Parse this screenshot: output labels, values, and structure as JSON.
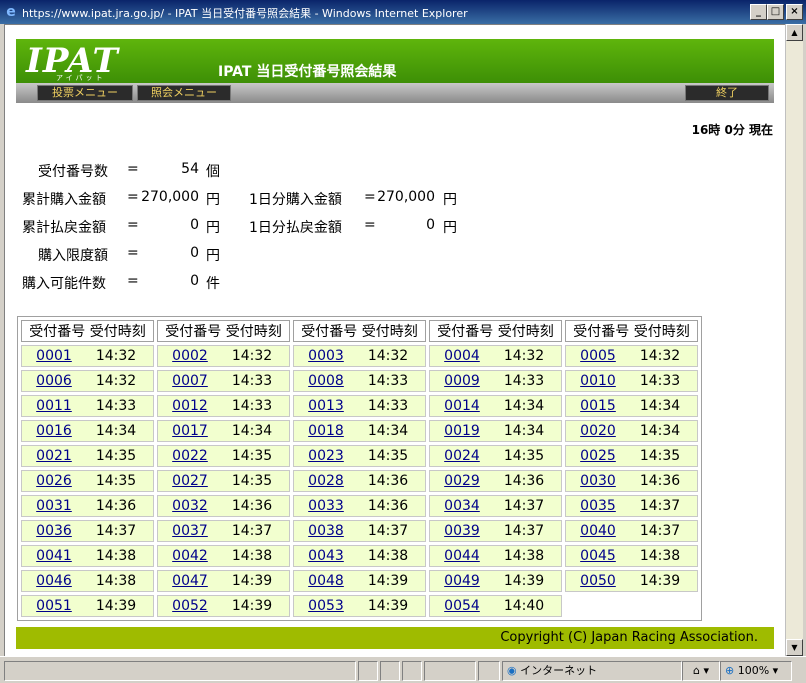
{
  "window": {
    "title": "https://www.ipat.jra.go.jp/ - IPAT 当日受付番号照会結果 - Windows Internet Explorer"
  },
  "header": {
    "logo": "IPAT",
    "logo_sub": "アイパット",
    "title": "IPAT 当日受付番号照会結果"
  },
  "nav": {
    "vote_menu": "投票メニュー",
    "inquiry_menu": "照会メニュー",
    "end": "終了"
  },
  "time": "16時 0分 現在",
  "summary": {
    "count_label": "受付番号数",
    "count_value": "54",
    "count_unit": "個",
    "total_buy_label": "累計購入金額",
    "total_buy_value": "270,000",
    "yen": "円",
    "day_buy_label": "1日分購入金額",
    "day_buy_value": "270,000",
    "total_pay_label": "累計払戻金額",
    "total_pay_value": "0",
    "day_pay_label": "1日分払戻金額",
    "day_pay_value": "0",
    "limit_label": "購入限度額",
    "limit_value": "0",
    "possible_label": "購入可能件数",
    "possible_value": "0",
    "possible_unit": "件",
    "eq": "="
  },
  "table": {
    "header": "受付番号 受付時刻",
    "rows": [
      [
        [
          "0001",
          "14:32"
        ],
        [
          "0002",
          "14:32"
        ],
        [
          "0003",
          "14:32"
        ],
        [
          "0004",
          "14:32"
        ],
        [
          "0005",
          "14:32"
        ]
      ],
      [
        [
          "0006",
          "14:32"
        ],
        [
          "0007",
          "14:33"
        ],
        [
          "0008",
          "14:33"
        ],
        [
          "0009",
          "14:33"
        ],
        [
          "0010",
          "14:33"
        ]
      ],
      [
        [
          "0011",
          "14:33"
        ],
        [
          "0012",
          "14:33"
        ],
        [
          "0013",
          "14:33"
        ],
        [
          "0014",
          "14:34"
        ],
        [
          "0015",
          "14:34"
        ]
      ],
      [
        [
          "0016",
          "14:34"
        ],
        [
          "0017",
          "14:34"
        ],
        [
          "0018",
          "14:34"
        ],
        [
          "0019",
          "14:34"
        ],
        [
          "0020",
          "14:34"
        ]
      ],
      [
        [
          "0021",
          "14:35"
        ],
        [
          "0022",
          "14:35"
        ],
        [
          "0023",
          "14:35"
        ],
        [
          "0024",
          "14:35"
        ],
        [
          "0025",
          "14:35"
        ]
      ],
      [
        [
          "0026",
          "14:35"
        ],
        [
          "0027",
          "14:35"
        ],
        [
          "0028",
          "14:36"
        ],
        [
          "0029",
          "14:36"
        ],
        [
          "0030",
          "14:36"
        ]
      ],
      [
        [
          "0031",
          "14:36"
        ],
        [
          "0032",
          "14:36"
        ],
        [
          "0033",
          "14:36"
        ],
        [
          "0034",
          "14:37"
        ],
        [
          "0035",
          "14:37"
        ]
      ],
      [
        [
          "0036",
          "14:37"
        ],
        [
          "0037",
          "14:37"
        ],
        [
          "0038",
          "14:37"
        ],
        [
          "0039",
          "14:37"
        ],
        [
          "0040",
          "14:37"
        ]
      ],
      [
        [
          "0041",
          "14:38"
        ],
        [
          "0042",
          "14:38"
        ],
        [
          "0043",
          "14:38"
        ],
        [
          "0044",
          "14:38"
        ],
        [
          "0045",
          "14:38"
        ]
      ],
      [
        [
          "0046",
          "14:38"
        ],
        [
          "0047",
          "14:39"
        ],
        [
          "0048",
          "14:39"
        ],
        [
          "0049",
          "14:39"
        ],
        [
          "0050",
          "14:39"
        ]
      ],
      [
        [
          "0051",
          "14:39"
        ],
        [
          "0052",
          "14:39"
        ],
        [
          "0053",
          "14:39"
        ],
        [
          "0054",
          "14:40"
        ]
      ]
    ]
  },
  "footer": "Copyright (C) Japan Racing Association.",
  "status": {
    "zone": "インターネット",
    "zoom": "100%"
  },
  "icons": {
    "title_icon": "ie-logo-icon",
    "minimize": "minimize-icon",
    "maximize": "maximize-icon",
    "close": "close-icon",
    "globe": "globe-icon",
    "zoom": "zoom-icon"
  },
  "colors": {
    "header_green": "#4ea30a",
    "cell_bg": "#f2ffcf",
    "footer_bg": "#9fbb00",
    "link": "#00008b"
  }
}
